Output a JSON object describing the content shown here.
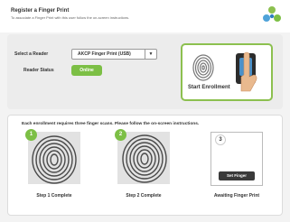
{
  "header": {
    "title": "Register a Finger Print",
    "subtitle": "To associate a Finger Print with this user follow the on-screen instructions.",
    "logo_icon": "akcp-logo-icon"
  },
  "reader": {
    "select_label": "Select a Reader",
    "selected_value": "AKCP Finger Print (USB)",
    "dropdown_icon": "chevron-down-icon",
    "status_label": "Reader Status",
    "status_value": "Online",
    "status_color": "#7cbf45"
  },
  "enroll": {
    "start_label": "Start Enrollment"
  },
  "steps": {
    "instruction": "Each enrollment requires three finger scans. Please follow the on-screen instructions.",
    "items": [
      {
        "number": "1",
        "caption": "Step 1 Complete"
      },
      {
        "number": "2",
        "caption": "Step 2 Complete"
      },
      {
        "number": "3",
        "caption": "Awaiting Finger Print",
        "button": "Set Finger"
      }
    ]
  }
}
